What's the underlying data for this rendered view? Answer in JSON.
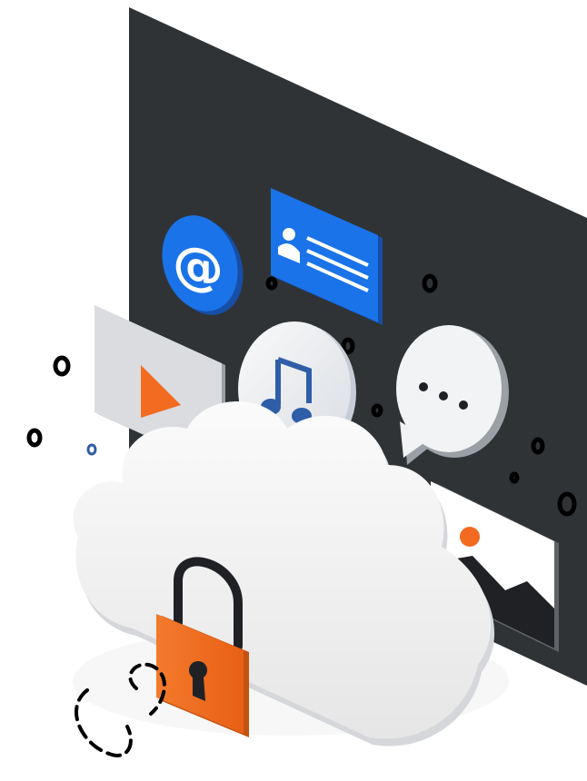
{
  "illustration": {
    "panel_color": "#2f3336",
    "accent_blue": "#1a73e8",
    "accent_orange": "#f26b21",
    "cloud_color": "#f1f1f1",
    "icons": {
      "email": {
        "name": "at-sign-icon",
        "glyph": "@"
      },
      "contact_card": {
        "name": "contact-card-icon"
      },
      "video": {
        "name": "play-icon"
      },
      "music": {
        "name": "music-note-icon"
      },
      "chat": {
        "name": "chat-bubble-icon"
      },
      "photo": {
        "name": "image-icon"
      },
      "cloud": {
        "name": "cloud-icon"
      },
      "lock": {
        "name": "padlock-icon"
      }
    }
  }
}
